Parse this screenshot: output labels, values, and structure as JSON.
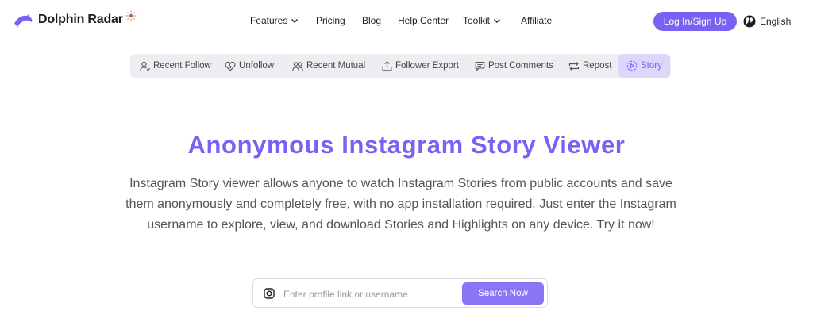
{
  "brand": {
    "name": "Dolphin Radar",
    "color": "#7b61f3"
  },
  "nav": {
    "items": [
      {
        "label": "Features",
        "dropdown": true
      },
      {
        "label": "Pricing",
        "dropdown": false
      },
      {
        "label": "Blog",
        "dropdown": false
      },
      {
        "label": "Help Center",
        "dropdown": false
      },
      {
        "label": "Toolkit",
        "dropdown": true
      },
      {
        "label": "Affiliate",
        "dropdown": false
      }
    ],
    "login_label": "Log In/Sign Up",
    "language": "English"
  },
  "tabs": [
    {
      "label": "Recent Follow",
      "icon": "user-follow-icon",
      "active": false
    },
    {
      "label": "Unfollow",
      "icon": "broken-heart-icon",
      "active": false
    },
    {
      "label": "Recent Mutual",
      "icon": "users-icon",
      "active": false
    },
    {
      "label": "Follower Export",
      "icon": "export-icon",
      "active": false
    },
    {
      "label": "Post Comments",
      "icon": "comment-icon",
      "active": false
    },
    {
      "label": "Repost",
      "icon": "repost-icon",
      "active": false
    },
    {
      "label": "Story",
      "icon": "story-icon",
      "active": true
    }
  ],
  "hero": {
    "title": "Anonymous Instagram Story Viewer",
    "description": "Instagram Story viewer allows anyone to watch Instagram Stories from public accounts and save them anonymously and completely free, with no app installation required. Just enter the Instagram username to explore, view, and download Stories and Highlights on any device. Try it now!"
  },
  "search": {
    "placeholder": "Enter profile link or username",
    "value": "",
    "button_label": "Search Now",
    "icon": "instagram-icon"
  }
}
